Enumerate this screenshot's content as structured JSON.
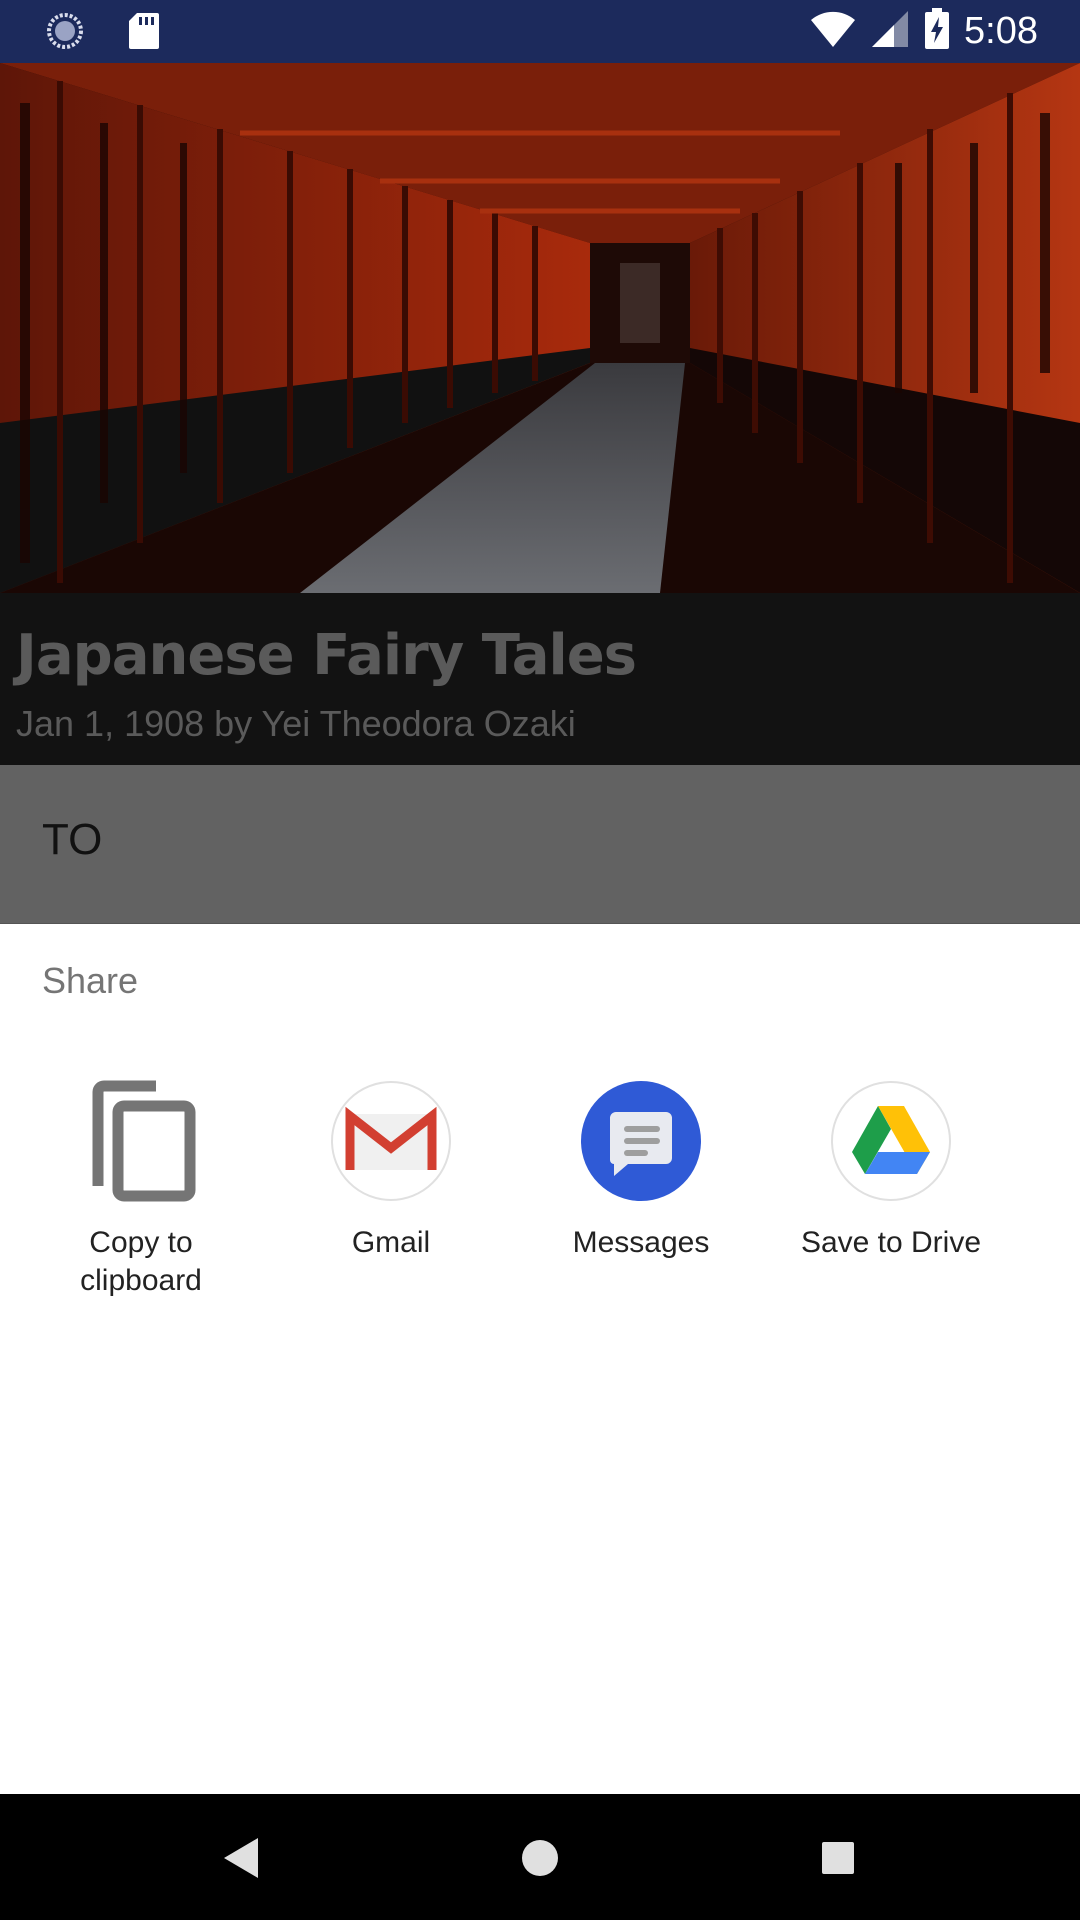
{
  "status_bar": {
    "time": "5:08",
    "icons": [
      "sync-icon",
      "sd-card-icon",
      "wifi-icon",
      "signal-icon",
      "battery-charging-icon"
    ]
  },
  "book": {
    "title": "Japanese Fairy Tales",
    "subtitle": "Jan 1, 1908 by Yei Theodora Ozaki"
  },
  "content": {
    "text": "TO"
  },
  "share_sheet": {
    "title": "Share",
    "targets": [
      {
        "label": "Copy to clipboard",
        "icon": "copy-icon"
      },
      {
        "label": "Gmail",
        "icon": "gmail-icon"
      },
      {
        "label": "Messages",
        "icon": "messages-icon"
      },
      {
        "label": "Save to Drive",
        "icon": "drive-icon"
      }
    ]
  },
  "nav_bar": {
    "buttons": [
      "back-icon",
      "home-icon",
      "recents-icon"
    ]
  },
  "colors": {
    "status_bar": "#1c2a5c",
    "torii_red": "#c2320f",
    "sheet_bg": "#ffffff",
    "messages_blue": "#2f5ad6"
  }
}
